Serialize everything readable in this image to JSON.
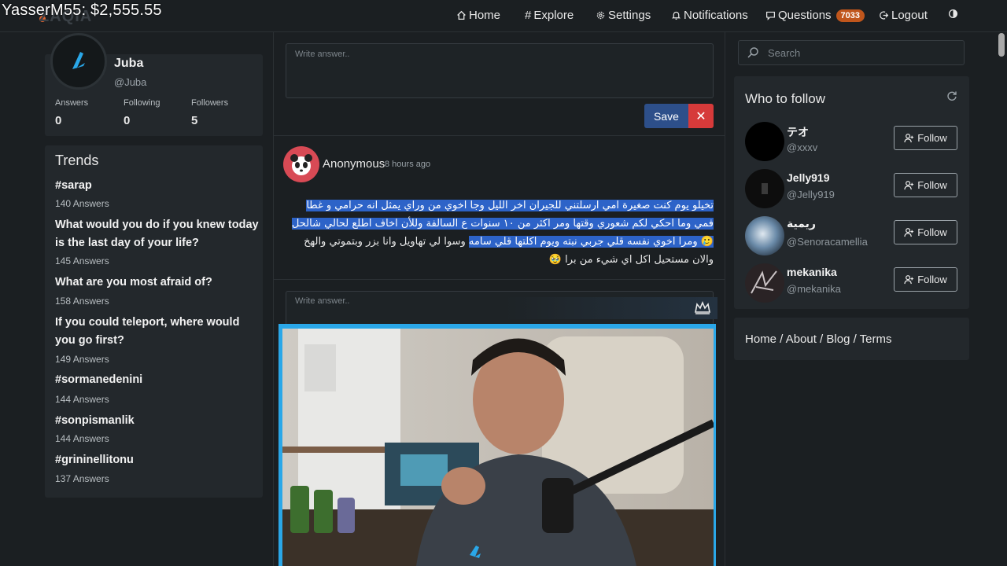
{
  "overlay": {
    "text": "YasserM55: $2,555.55"
  },
  "logo": {
    "text": "ZAQIA"
  },
  "nav": {
    "home": "Home",
    "explore": "Explore",
    "settings": "Settings",
    "notifications": "Notifications",
    "questions": "Questions",
    "questions_count": "7033",
    "logout": "Logout"
  },
  "profile": {
    "name": "Juba",
    "handle": "@Juba",
    "answers_label": "Answers",
    "answers": "0",
    "following_label": "Following",
    "following": "0",
    "followers_label": "Followers",
    "followers": "5"
  },
  "trends": {
    "title": "Trends",
    "items": [
      {
        "title": "#sarap",
        "count": "140 Answers"
      },
      {
        "title": "What would you do if you knew today is the last day of your life?",
        "count": "145 Answers"
      },
      {
        "title": "What are you most afraid of?",
        "count": "158 Answers"
      },
      {
        "title": "If you could teleport, where would you go first?",
        "count": "149 Answers"
      },
      {
        "title": "#sormanedenini",
        "count": "144 Answers"
      },
      {
        "title": "#sonpismanlik",
        "count": "144 Answers"
      },
      {
        "title": "#grininellitonu",
        "count": "137 Answers"
      }
    ]
  },
  "composer": {
    "placeholder": "Write answer..",
    "save": "Save",
    "close": "✕"
  },
  "post": {
    "user": "Anonymous",
    "time": "8 hours ago",
    "body_highlighted": "تخيلو يوم كنت صغيرة امي ارسلتني للجيران اخر الليل وجا اخوي من وراي يمثل انه حرامي و غطا فمي وما احكي لكم شعوري وقتها ومر اكثر من ١٠ سنوات ع السالفة وللأن اخاف اطلع لحالي شالحل 🥲 ومرا اخوي نفسه قلي جربي نبته ويوم اكلتها قلي سامه",
    "body_rest": "وسوا لي تهاويل وانا بزر وبتموتي والهخ والان مستحيل اكل اي شيء من برا 🥹",
    "answer_placeholder": "Write answer.."
  },
  "sidebar": {
    "search_placeholder": "Search",
    "who_to_follow": "Who to follow",
    "follow_label": "Follow",
    "users": [
      {
        "name": "テオ",
        "handle": "@xxxv"
      },
      {
        "name": "Jelly919",
        "handle": "@Jelly919"
      },
      {
        "name": "ريمية",
        "handle": "@Senoracamellia"
      },
      {
        "name": "mekanika",
        "handle": "@mekanika"
      }
    ],
    "footer": "Home / About / Blog / Terms"
  },
  "colors": {
    "accent": "#2d4f8a",
    "danger": "#d63a3a",
    "badge": "#c0561c",
    "highlight": "#2d63c8",
    "cam_border": "#2aa7e8"
  }
}
